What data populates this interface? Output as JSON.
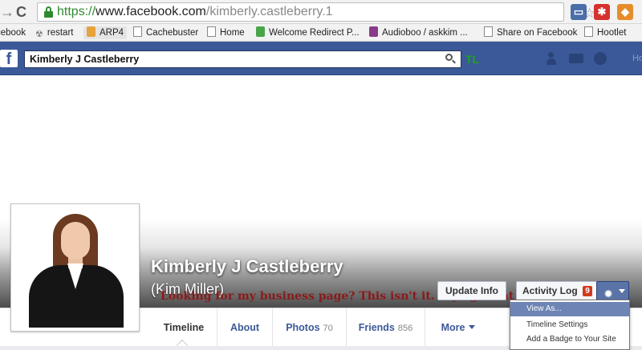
{
  "browser": {
    "url": {
      "scheme": "https://",
      "host": "www.facebook.com",
      "path": "/kimberly.castleberry.1"
    },
    "bookmarks": [
      {
        "label": "cebook",
        "icon": "none"
      },
      {
        "label": "restart",
        "icon": "radiation-icon"
      },
      {
        "label": "ARP4",
        "icon": "arp-icon"
      },
      {
        "label": "Cachebuster",
        "icon": "page-icon"
      },
      {
        "label": "Home",
        "icon": "page-icon"
      },
      {
        "label": "Welcome Redirect P...",
        "icon": "green-app-icon"
      },
      {
        "label": "Audioboo / askkim ...",
        "icon": "audioboo-icon"
      },
      {
        "label": "Share on Facebook",
        "icon": "page-icon"
      },
      {
        "label": "Hootlet",
        "icon": "page-icon"
      }
    ]
  },
  "facebook": {
    "logo": "f",
    "search_value": "Kimberly J Castleberry",
    "tl_label": "TL",
    "home_label": "Hom",
    "brand_color": "#3b5998"
  },
  "profile": {
    "name": "Kimberly J Castleberry",
    "alternate_name": "(Kim Miller)",
    "cover_message": "Looking for my business page? This isn't it. Try again at kim"
  },
  "actions": {
    "update_info": "Update Info",
    "activity_log": "Activity Log",
    "activity_badge": "9"
  },
  "tabs": [
    {
      "label": "Timeline",
      "count": ""
    },
    {
      "label": "About",
      "count": ""
    },
    {
      "label": "Photos",
      "count": "70"
    },
    {
      "label": "Friends",
      "count": "856"
    },
    {
      "label": "More",
      "count": ""
    }
  ],
  "settings_menu": {
    "items": [
      "View As...",
      "Timeline Settings",
      "Add a Badge to Your Site"
    ],
    "highlighted": "View As..."
  }
}
